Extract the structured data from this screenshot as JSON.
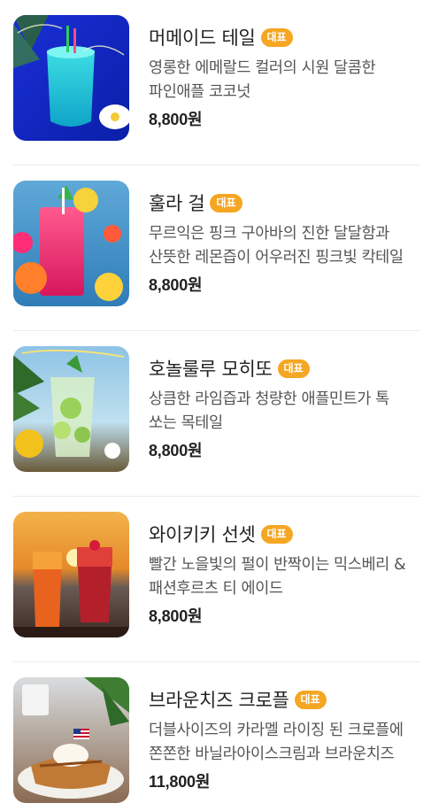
{
  "menu": {
    "items": [
      {
        "name": "머메이드 테일",
        "badge": "대표",
        "description": "영롱한 에메랄드 컬러의 시원 달콤한 파인애플 코코넛",
        "price": "8,800원",
        "image": "blue-cocktail-photo"
      },
      {
        "name": "훌라 걸",
        "badge": "대표",
        "description": "무르익은 핑크 구아바의 진한 달달함과 산뜻한 레몬즙이 어우러진 핑크빛 칵테일",
        "price": "8,800원",
        "image": "pink-cocktail-photo"
      },
      {
        "name": "호놀룰루 모히또",
        "badge": "대표",
        "description": "상큼한 라임즙과 청량한 애플민트가 톡 쏘는 목테일",
        "price": "8,800원",
        "image": "mojito-photo"
      },
      {
        "name": "와이키키 선셋",
        "badge": "대표",
        "description": "빨간 노을빛의 펄이 반짝이는 믹스베리 & 패션후르츠 티 에이드",
        "price": "8,800원",
        "image": "sunset-drinks-photo"
      },
      {
        "name": "브라운치즈 크로플",
        "badge": "대표",
        "description": "더블사이즈의 카라멜 라이징 된 크로플에 쫀쫀한 바닐라아이스크림과 브라운치즈",
        "price": "11,800원",
        "image": "croffle-photo"
      }
    ]
  }
}
